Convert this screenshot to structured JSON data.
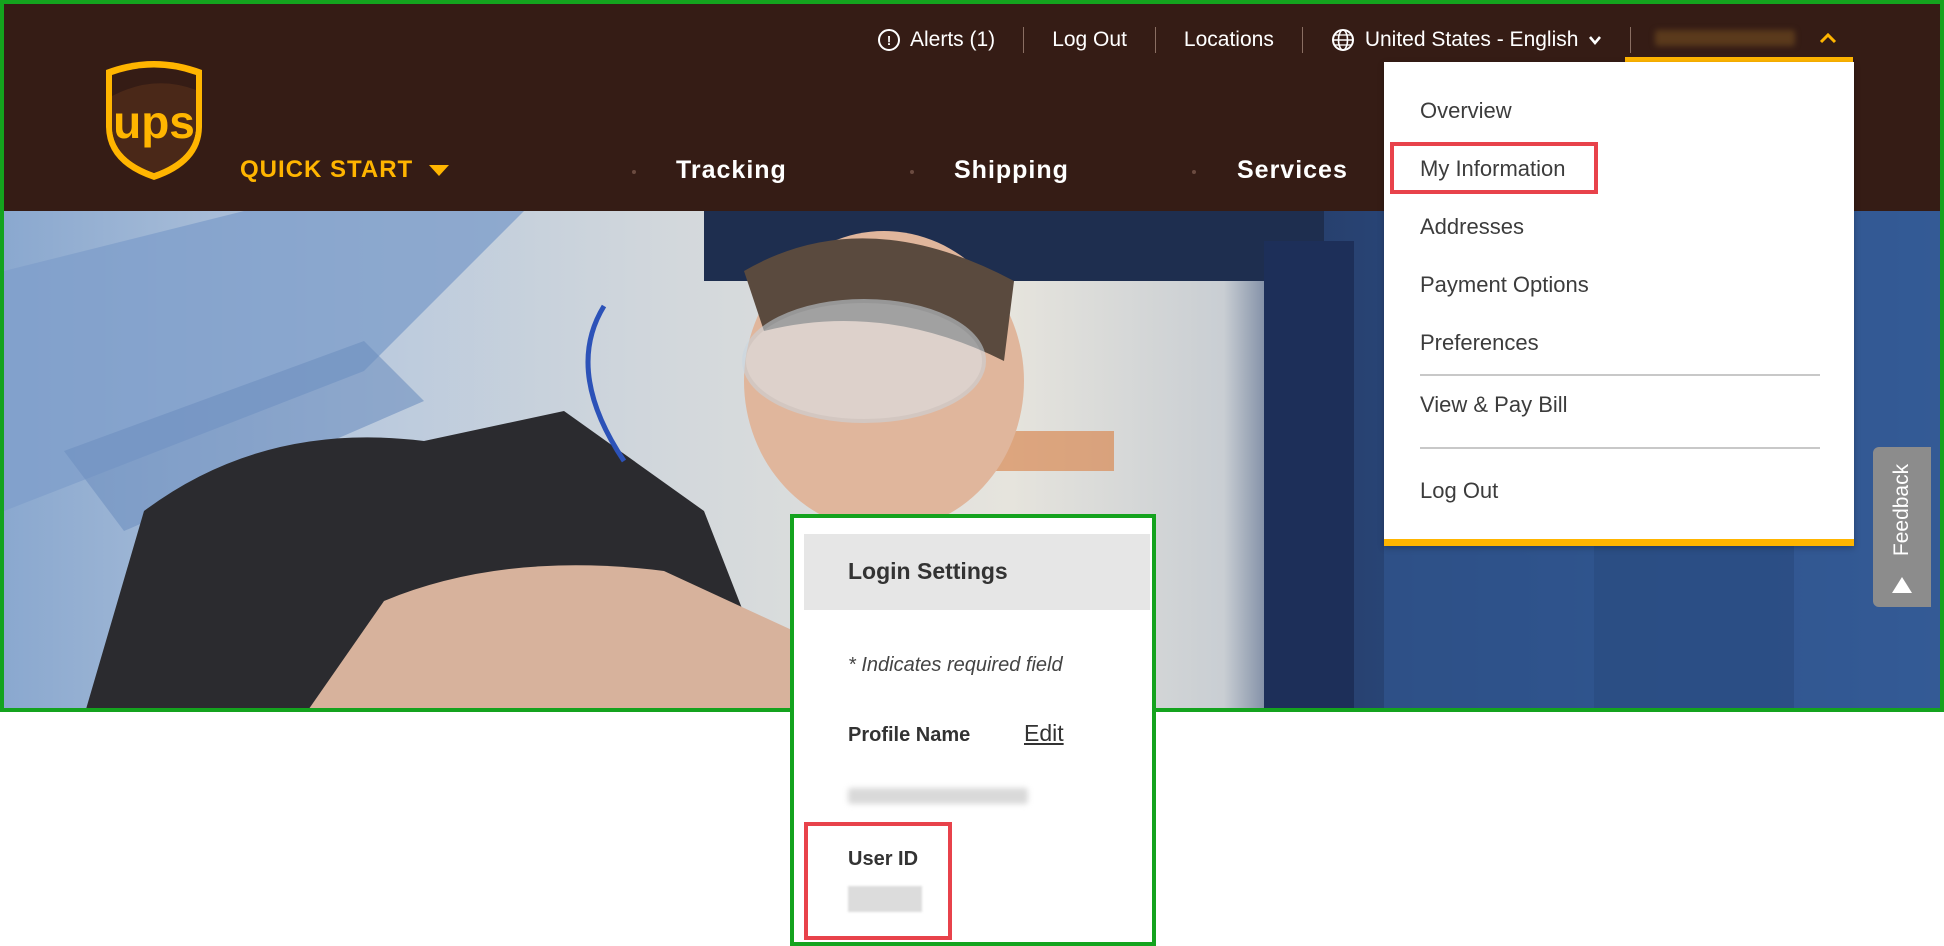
{
  "header": {
    "alerts_label": "Alerts (1)",
    "logout_label": "Log Out",
    "locations_label": "Locations",
    "language_label": "United States - English",
    "quick_start_label": "QUICK START",
    "nav": [
      "Tracking",
      "Shipping",
      "Services"
    ],
    "brand_text": "ups"
  },
  "account_menu": {
    "items": [
      "Overview",
      "My Information",
      "Addresses",
      "Payment Options",
      "Preferences",
      "View & Pay Bill",
      "Log Out"
    ]
  },
  "feedback": {
    "label": "Feedback"
  },
  "login_settings": {
    "title": "Login Settings",
    "required_note": "* Indicates required field",
    "profile_name_label": "Profile Name",
    "edit_label": "Edit",
    "user_id_label": "User ID"
  },
  "colors": {
    "header_brown": "#351c15",
    "ups_gold": "#ffb500",
    "highlight_red": "#e8424b",
    "frame_green": "#14a31e"
  }
}
